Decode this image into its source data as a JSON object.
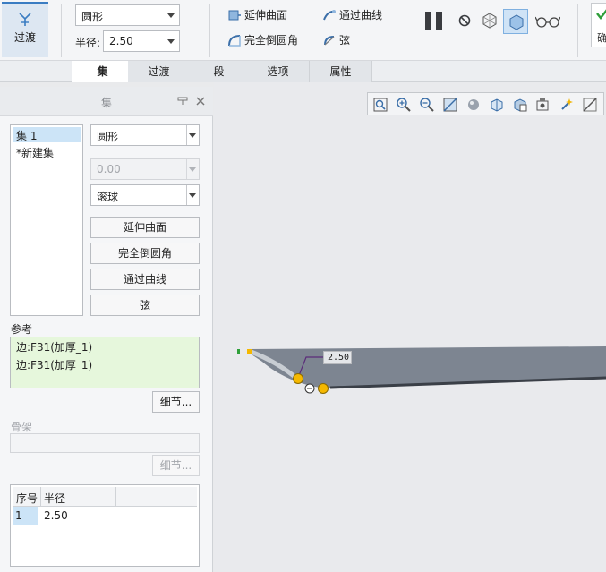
{
  "ribbon": {
    "transition_label": "过渡",
    "shape_value": "圆形",
    "radius_label": "半径:",
    "radius_value": "2.50",
    "extend_surfaces": "延伸曲面",
    "full_round": "完全倒圆角",
    "through_curve": "通过曲线",
    "chord": "弦",
    "right_partial_label": "确"
  },
  "tabs": [
    "集",
    "过渡",
    "段",
    "选项",
    "属性"
  ],
  "panel": {
    "title": "集",
    "sets": [
      "集 1",
      "*新建集"
    ],
    "shape_value": "圆形",
    "disabled_value": "0.00",
    "method_value": "滚球",
    "buttons": [
      "延伸曲面",
      "完全倒圆角",
      "通过曲线",
      "弦"
    ],
    "reference_label": "参考",
    "references": [
      "边:F31(加厚_1)",
      "边:F31(加厚_1)"
    ],
    "details_button": "细节...",
    "skeleton_label": "骨架",
    "details_button_disabled": "细节...",
    "table": {
      "headers": [
        "序号",
        "半径"
      ],
      "rows": [
        [
          "1",
          "2.50"
        ]
      ]
    }
  },
  "viewport": {
    "dimension_label": "2.50"
  },
  "colors": {
    "accent": "#3a7cc2",
    "selection": "#cce4f7",
    "reference_bg": "#e6f7dc",
    "model_gray": "#7d8591",
    "handle_yellow": "#f5b800"
  }
}
